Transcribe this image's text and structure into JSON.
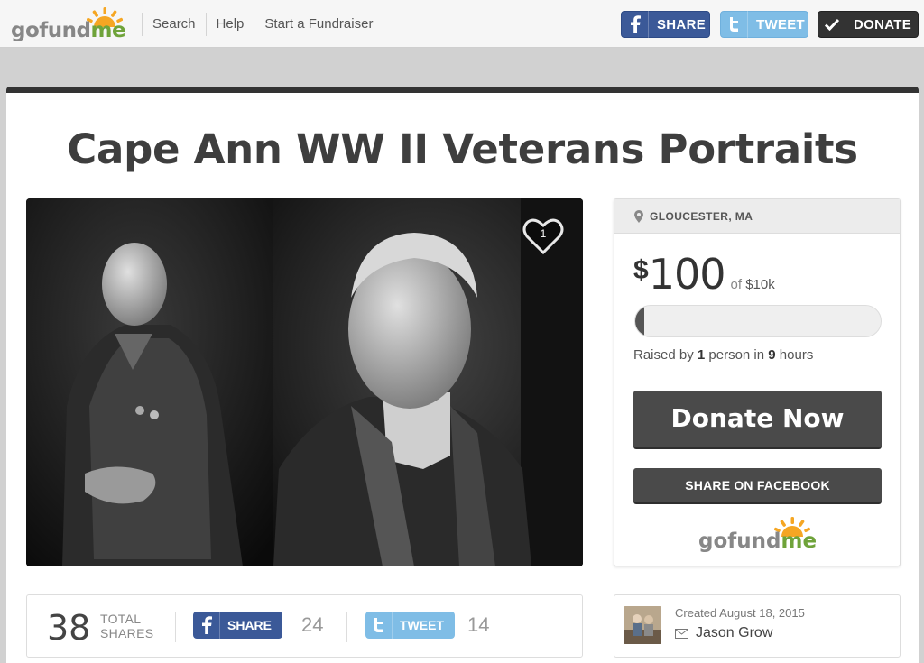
{
  "header": {
    "logo": {
      "part1": "gofund",
      "part2": "me"
    },
    "nav": [
      "Search",
      "Help",
      "Start a Fundraiser"
    ],
    "share_label": "SHARE",
    "tweet_label": "TWEET",
    "donate_label": "DONATE"
  },
  "campaign": {
    "title": "Cape Ann WW II Veterans Portraits",
    "likes": "1",
    "location": "GLOUCESTER, MA",
    "currency": "$",
    "raised": "100",
    "goal_prefix": "of",
    "goal": "$10k",
    "progress_fraction": 0.01,
    "raised_by_prefix": "Raised by",
    "raised_by_count": "1",
    "raised_by_mid": "person in",
    "raised_by_time": "9",
    "raised_by_suffix": "hours",
    "donate_now": "Donate Now",
    "share_facebook": "SHARE ON FACEBOOK"
  },
  "shares": {
    "total": "38",
    "total_label_1": "TOTAL",
    "total_label_2": "SHARES",
    "facebook_label": "SHARE",
    "facebook_count": "24",
    "twitter_label": "TWEET",
    "twitter_count": "14"
  },
  "organizer": {
    "created": "Created August 18, 2015",
    "name": "Jason Grow"
  },
  "colors": {
    "facebook": "#3b5998",
    "twitter": "#7fbde6",
    "brand_green": "#6fa33a",
    "brand_orange": "#f5a623",
    "dark_button": "#4a4a4a"
  },
  "icons": [
    "facebook-icon",
    "twitter-icon",
    "checkmark-icon",
    "heart-icon",
    "location-pin-icon",
    "envelope-icon"
  ]
}
